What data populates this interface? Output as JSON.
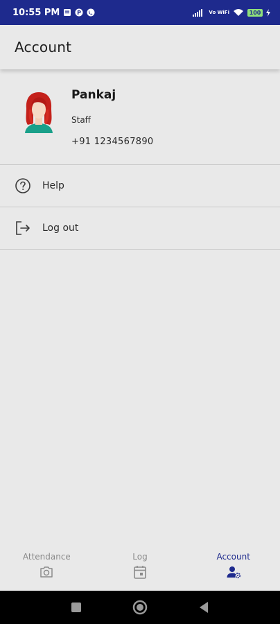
{
  "status_bar": {
    "time": "10:55 PM",
    "network_label": "Vo WiFi",
    "battery": "100",
    "icons": [
      "gallery-icon",
      "p-icon",
      "phone-icon",
      "signal-icon",
      "wifi-icon",
      "battery-icon",
      "charging-icon"
    ]
  },
  "app_bar": {
    "title": "Account"
  },
  "profile": {
    "name": "Pankaj",
    "role": "Staff",
    "phone": "+91 1234567890"
  },
  "menu": [
    {
      "label": "Help",
      "icon": "help-icon"
    },
    {
      "label": "Log out",
      "icon": "logout-icon"
    }
  ],
  "bottom_nav": {
    "items": [
      {
        "label": "Attendance",
        "icon": "camera-icon",
        "active": false
      },
      {
        "label": "Log",
        "icon": "calendar-icon",
        "active": false
      },
      {
        "label": "Account",
        "icon": "account-settings-icon",
        "active": true
      }
    ]
  },
  "colors": {
    "primary": "#1e2a8d",
    "background": "#e9e9e9",
    "inactive_nav": "#8a8a8a"
  }
}
